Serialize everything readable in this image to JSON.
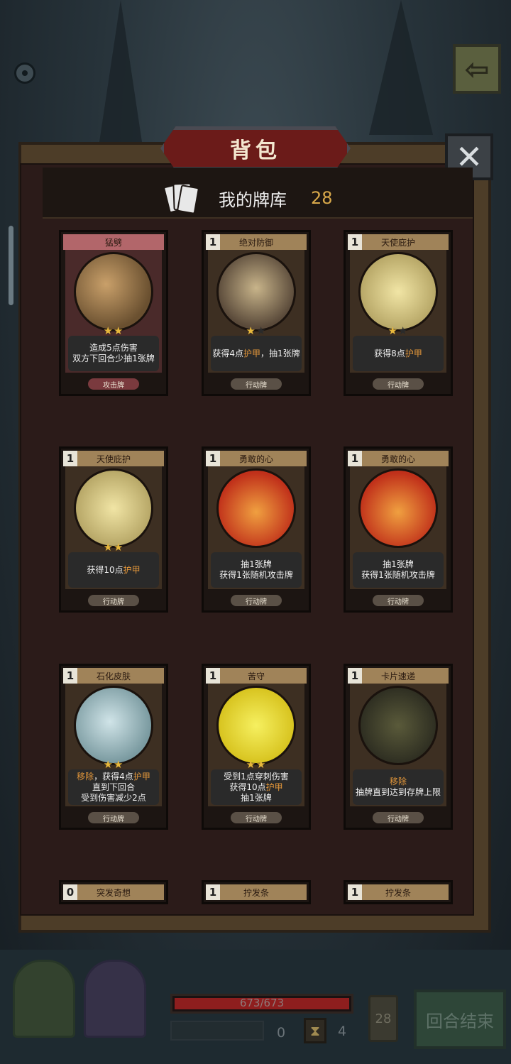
{
  "panel": {
    "title": "背包",
    "deck_label": "我的牌库",
    "deck_count": "28"
  },
  "cards": [
    {
      "name": "猛劈",
      "cost": "",
      "stars": 2,
      "desc": [
        "造成5点伤害",
        "双方下回合少抽1张牌"
      ],
      "type": "攻击牌",
      "kind": "attack"
    },
    {
      "name": "绝对防御",
      "cost": "1",
      "stars": 1,
      "desc": [
        "获得4点护甲，抽1张牌"
      ],
      "type": "行动牌",
      "kind": "action"
    },
    {
      "name": "天使庇护",
      "cost": "1",
      "stars": 1,
      "desc": [
        "获得8点护甲"
      ],
      "type": "行动牌",
      "kind": "action"
    },
    {
      "name": "天使庇护",
      "cost": "1",
      "stars": 2,
      "desc": [
        "获得10点护甲"
      ],
      "type": "行动牌",
      "kind": "action"
    },
    {
      "name": "勇敢的心",
      "cost": "1",
      "stars": 0,
      "desc": [
        "抽1张牌",
        "获得1张随机攻击牌"
      ],
      "type": "行动牌",
      "kind": "action"
    },
    {
      "name": "勇敢的心",
      "cost": "1",
      "stars": 0,
      "desc": [
        "抽1张牌",
        "获得1张随机攻击牌"
      ],
      "type": "行动牌",
      "kind": "action"
    },
    {
      "name": "石化皮肤",
      "cost": "1",
      "stars": 2,
      "desc": [
        "移除，获得4点护甲",
        "直到下回合",
        "受到伤害减少2点"
      ],
      "type": "行动牌",
      "kind": "action"
    },
    {
      "name": "苦守",
      "cost": "1",
      "stars": 2,
      "desc": [
        "受到1点穿刺伤害",
        "获得10点护甲",
        "抽1张牌"
      ],
      "type": "行动牌",
      "kind": "action"
    },
    {
      "name": "卡片速递",
      "cost": "1",
      "stars": 0,
      "desc": [
        "移除",
        "抽牌直到达到存牌上限"
      ],
      "type": "行动牌",
      "kind": "action"
    },
    {
      "name": "突发奇想",
      "cost": "0",
      "partial": true
    },
    {
      "name": "拧发条",
      "cost": "1",
      "partial": true
    },
    {
      "name": "拧发条",
      "cost": "1",
      "partial": true
    }
  ],
  "hud": {
    "hp_text": "673/673",
    "hp_fraction": 1.0,
    "energy": "0",
    "turns": "4",
    "draw_count": "28",
    "end_turn_label": "回合结束"
  }
}
